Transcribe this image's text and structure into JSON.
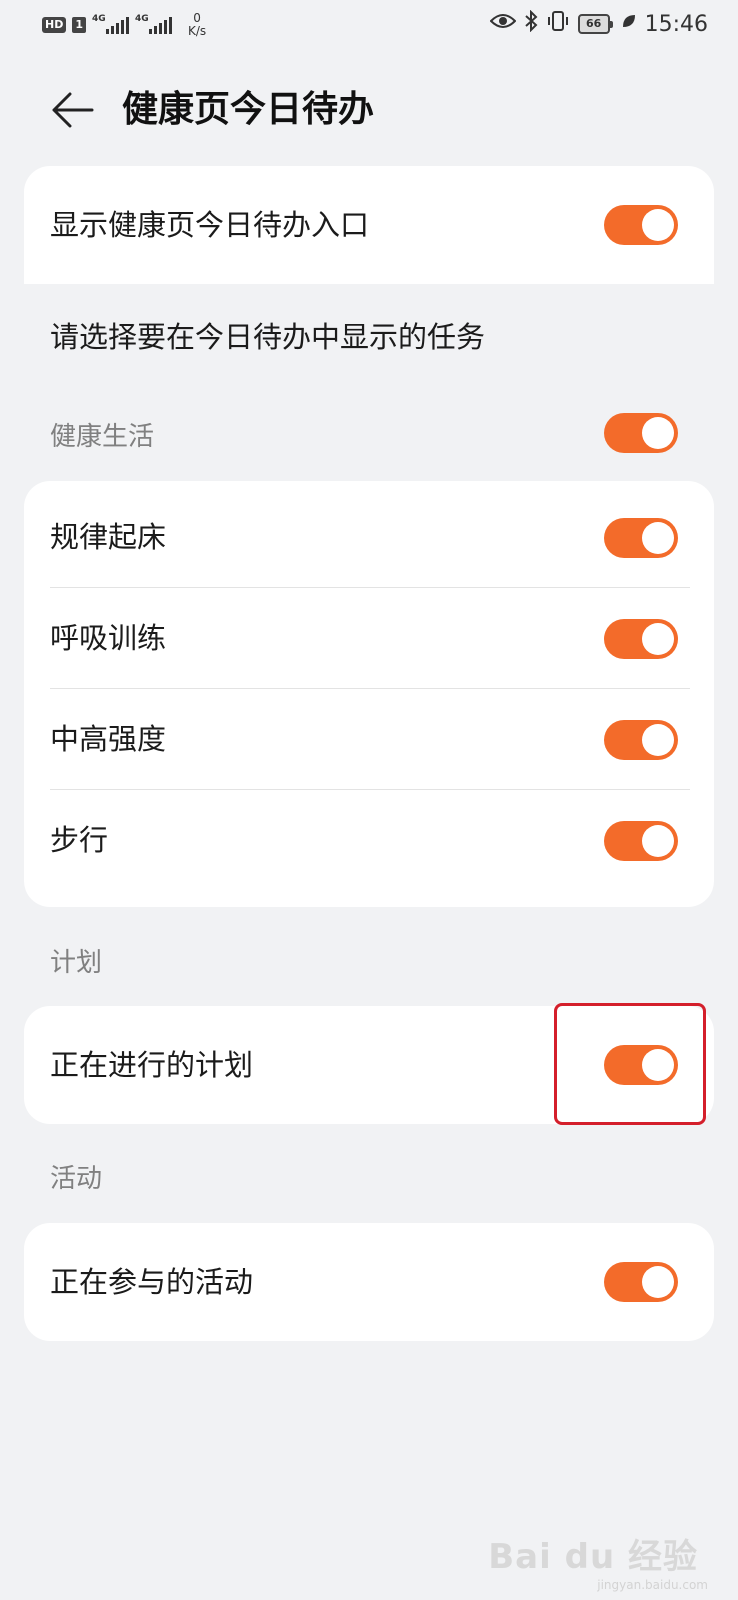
{
  "status_bar": {
    "hd_badge": "HD",
    "sim_badge": "1",
    "signal1_label": "4G",
    "signal2_label": "4G",
    "speed_value": "0",
    "speed_unit": "K/s",
    "battery_level": "66",
    "time": "15:46"
  },
  "header": {
    "back_icon": "arrow-left-icon",
    "title": "健康页今日待办"
  },
  "entry_card": {
    "label": "显示健康页今日待办入口",
    "on": true
  },
  "select_prompt": "请选择要在今日待办中显示的任务",
  "health_section": {
    "label": "健康生活",
    "on": true,
    "items": [
      {
        "label": "规律起床",
        "on": true
      },
      {
        "label": "呼吸训练",
        "on": true
      },
      {
        "label": "中高强度",
        "on": true
      },
      {
        "label": "步行",
        "on": true
      }
    ]
  },
  "plan_section": {
    "label": "计划",
    "item": {
      "label": "正在进行的计划",
      "on": true
    }
  },
  "activity_section": {
    "label": "活动",
    "item": {
      "label": "正在参与的活动",
      "on": true
    }
  },
  "watermark": {
    "text": "Bai du 经验",
    "sub": "jingyan.baidu.com"
  },
  "colors": {
    "accent": "#f36b2a",
    "highlight_box": "#d41f2b",
    "background": "#f1f2f4"
  }
}
